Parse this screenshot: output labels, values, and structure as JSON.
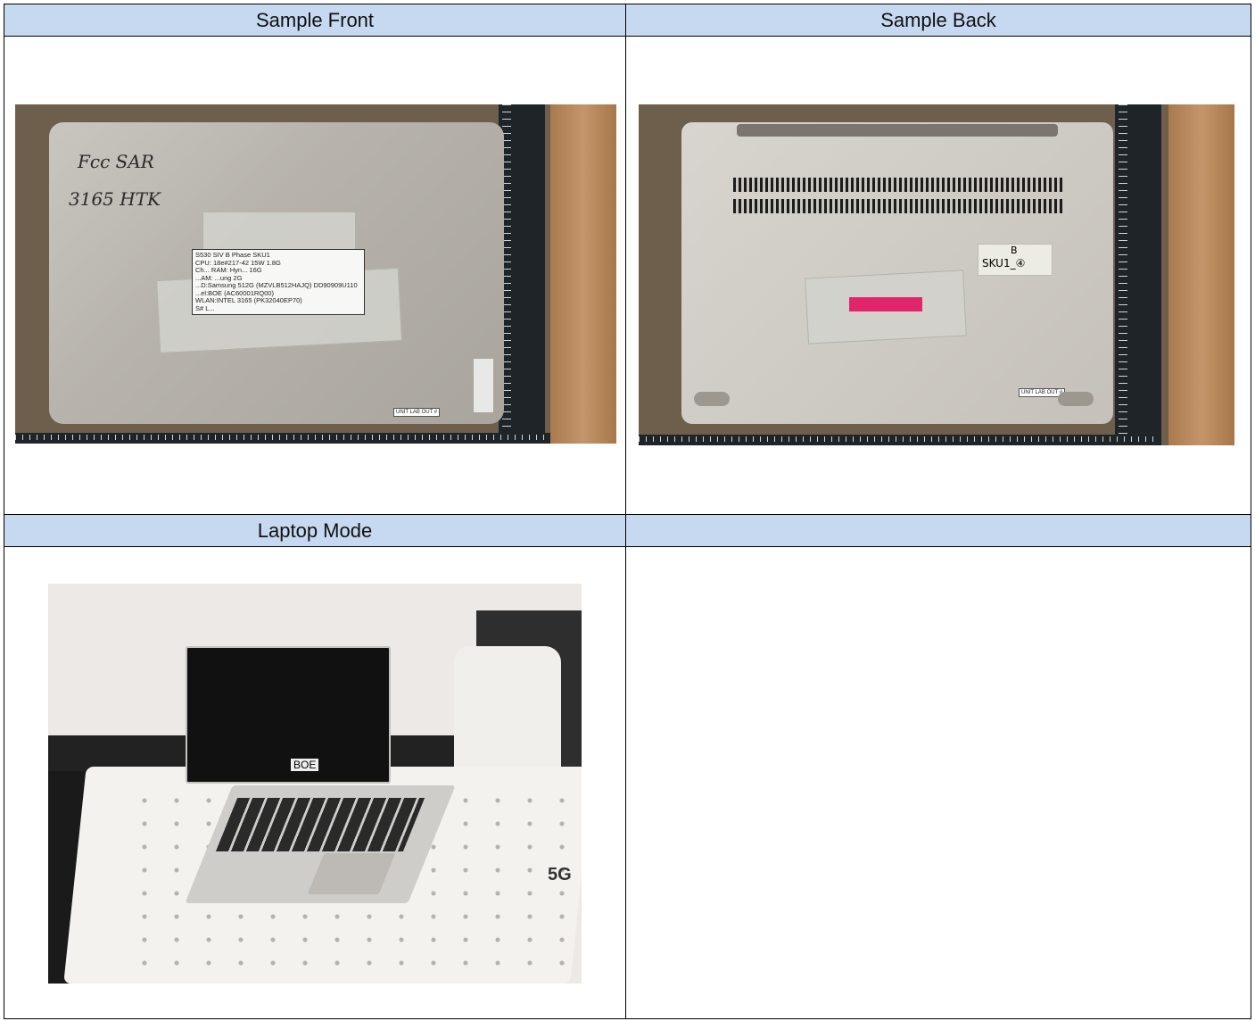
{
  "table": {
    "headers": {
      "front": "Sample Front",
      "back": "Sample Back",
      "laptop_mode": "Laptop Mode",
      "empty": ""
    }
  },
  "photos": {
    "front": {
      "handwriting_line1": "Fcc SAR",
      "handwriting_line2": "3165 HTK",
      "label_lines": [
        "S530  SIV  B  Phase  SKU1",
        "CPU: 18e#217-42  15W 1.8G",
        "Ch...  RAM: Hyn... 16G",
        "...AM: ...ung 2G",
        "...D:Samsung 512G (MZVLB512HAJQ) DD90909U110",
        "...el:BOE (AC60001RQ00)",
        "WLAN:INTEL 3165 (PK32040EP70)",
        "S# L..."
      ],
      "tag_text": "UNIT LAB  OUT #"
    },
    "back": {
      "sku_label_line1": "B",
      "sku_label_line2": "SKU1_④",
      "tag_text": "UNIT LAB  OUT #"
    },
    "laptop": {
      "sticker_text": "BOE",
      "board_text": "5G"
    }
  },
  "colors": {
    "header_bg": "#c6d9f1",
    "border": "#000000"
  }
}
